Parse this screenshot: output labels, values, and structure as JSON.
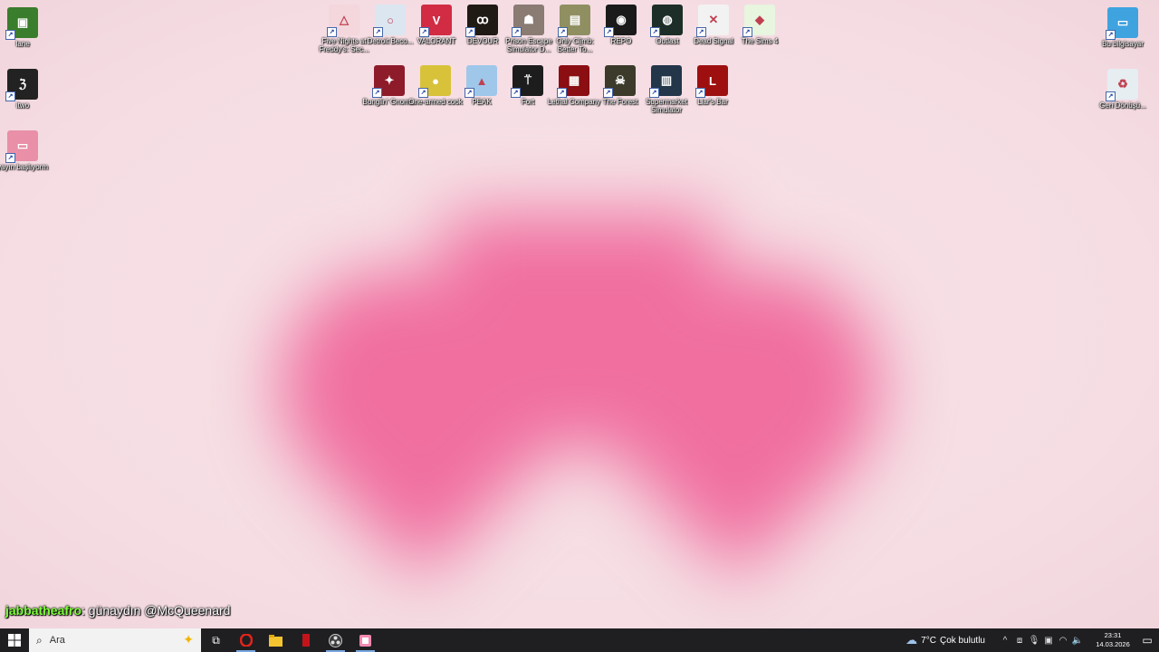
{
  "desktop": {
    "icons_left": [
      {
        "label": "Iane",
        "color": "#3a7d2c",
        "glyph": "▣"
      },
      {
        "label": "itwo",
        "color": "#222222",
        "glyph": "ℨ"
      },
      {
        "label": "yayın başlıyorm",
        "color": "#e98fa7",
        "glyph": "▭"
      }
    ],
    "icons_row1": [
      {
        "label": "Five Nights at Freddy's: Sec...",
        "color": "#f3d7dc",
        "glyph": "△"
      },
      {
        "label": "Detroit Beco...",
        "color": "#dbe6f0",
        "glyph": "○"
      },
      {
        "label": "VALORANT",
        "color": "#d12c44",
        "glyph": "V"
      },
      {
        "label": "DEVOUR",
        "color": "#201a14",
        "glyph": "ꝏ"
      },
      {
        "label": "Prison Escape Simulator D...",
        "color": "#8a7b73",
        "glyph": "☗"
      },
      {
        "label": "Only Climb: Better To...",
        "color": "#8f8f62",
        "glyph": "▤"
      },
      {
        "label": "REPO",
        "color": "#1a1a1a",
        "glyph": "◉"
      },
      {
        "label": "Outlast",
        "color": "#1c2e27",
        "glyph": "◍"
      },
      {
        "label": "Dead Signal",
        "color": "#f2f2f2",
        "glyph": "✕"
      },
      {
        "label": "The Sims 4",
        "color": "#e8f5df",
        "glyph": "◆"
      }
    ],
    "icons_row2": [
      {
        "label": "Bunglin' Gnom...",
        "color": "#8e1b2a",
        "glyph": "✦"
      },
      {
        "label": "One-armed cook",
        "color": "#d8c23a",
        "glyph": "●"
      },
      {
        "label": "PEAK",
        "color": "#9fc7ea",
        "glyph": "▲"
      },
      {
        "label": "Fort",
        "color": "#1d1d1d",
        "glyph": "⍡"
      },
      {
        "label": "Lethal Company",
        "color": "#8a0e12",
        "glyph": "▦"
      },
      {
        "label": "The Forest",
        "color": "#3c3a2a",
        "glyph": "☠"
      },
      {
        "label": "Supermarket Simulator",
        "color": "#23364a",
        "glyph": "▥"
      },
      {
        "label": "Liar's Bar",
        "color": "#9e1010",
        "glyph": "L"
      }
    ],
    "icons_right": [
      {
        "label": "Bu bilgisayar",
        "color": "#3fa3e0",
        "glyph": "▭"
      },
      {
        "label": "Geri Dönüşü...",
        "color": "#e6eef2",
        "glyph": "♻"
      }
    ]
  },
  "chat": {
    "username": "jabbatheafro",
    "separator": ": ",
    "message": "günaydın @McQueenard"
  },
  "taskbar": {
    "search_placeholder": "Ara",
    "weather_temp": "7°C",
    "weather_desc": "Çok bulutlu",
    "time": "23:31",
    "date": "14.03.2026",
    "accent": "#7aa7e0"
  }
}
